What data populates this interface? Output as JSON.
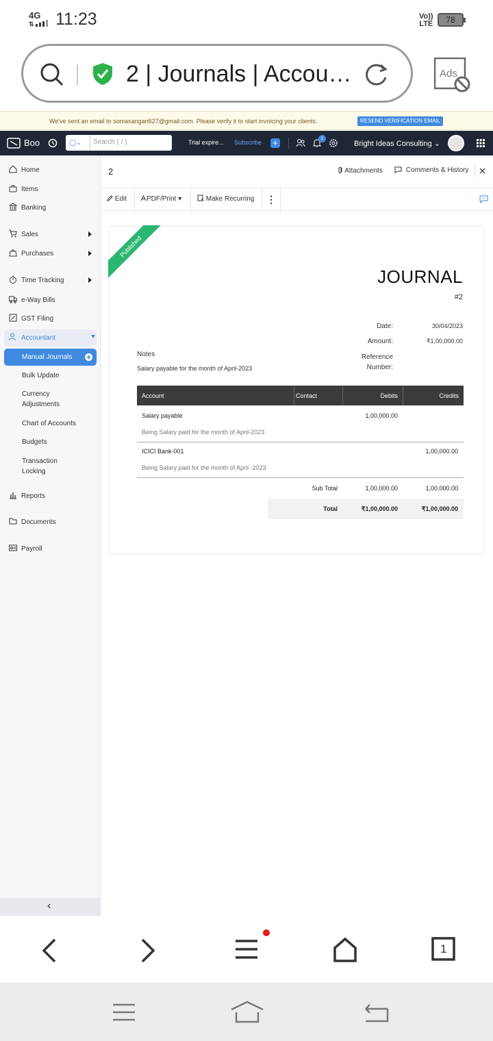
{
  "status_bar": {
    "network": "4G",
    "time": "11:23",
    "volte_line1": "Vo))",
    "volte_line2": "LTE",
    "battery": "78"
  },
  "browser": {
    "url_title": "2 | Journals | Accoun...",
    "ads_label": "Ads"
  },
  "banner": {
    "text": "We've sent an email to somasangari627@gmail.com. Please verify it to start invoicing your clients.",
    "button": "RESEND VERIFICATION EMAIL"
  },
  "topnav": {
    "brand": "Boo",
    "search_placeholder": "Search ( / )",
    "trial": "Trial expire...",
    "subscribe": "Subscribe",
    "plus": "+",
    "notif_count": "1",
    "org": "Bright Ideas Consulting"
  },
  "sidebar": {
    "home": "Home",
    "items": "Items",
    "banking": "Banking",
    "sales": "Sales",
    "purchases": "Purchases",
    "time_tracking": "Time Tracking",
    "eway": "e-Way Bills",
    "gst": "GST Filing",
    "accountant": "Accountant",
    "manual_journals": "Manual Journals",
    "bulk_update": "Bulk Update",
    "currency_adj_1": "Currency",
    "currency_adj_2": "Adjustments",
    "chart_of_accounts": "Chart of Accounts",
    "budgets": "Budgets",
    "txn_lock_1": "Transaction",
    "txn_lock_2": "Locking",
    "reports": "Reports",
    "documents": "Documents",
    "payroll": "Payroll",
    "collapse": "‹"
  },
  "header": {
    "title": "2",
    "attachments": "Attachments",
    "comments": "Comments & History"
  },
  "toolbar": {
    "edit": "Edit",
    "pdf": "PDF/Print",
    "recurring": "Make Recurring"
  },
  "journal": {
    "ribbon": "Published",
    "title": "JOURNAL",
    "number": "#2",
    "date_label": "Date:",
    "date": "30/04/2023",
    "amount_label": "Amount:",
    "amount": "₹1,00,000.00",
    "ref_label_1": "Reference",
    "ref_label_2": "Number:",
    "notes_label": "Notes",
    "notes": "Salary payable for the month of April-2023",
    "columns": {
      "account": "Account",
      "contact": "Contact",
      "debits": "Debits",
      "credits": "Credits"
    },
    "rows": [
      {
        "account": "Salary payable",
        "contact": "",
        "debit": "1,00,000.00",
        "credit": "",
        "desc": "Being Salary paid for the month of April-2023"
      },
      {
        "account": "ICICI Bank-001",
        "contact": "",
        "debit": "",
        "credit": "1,00,000.00",
        "desc": "Being Salary paid for the month of April -2023"
      }
    ],
    "subtotal_label": "Sub Total",
    "subtotal_debit": "1,00,000.00",
    "subtotal_credit": "1,00,000.00",
    "total_label": "Total",
    "total_debit": "₹1,00,000.00",
    "total_credit": "₹1,00,000.00"
  },
  "bottom_nav": {
    "tabs_count": "1"
  }
}
